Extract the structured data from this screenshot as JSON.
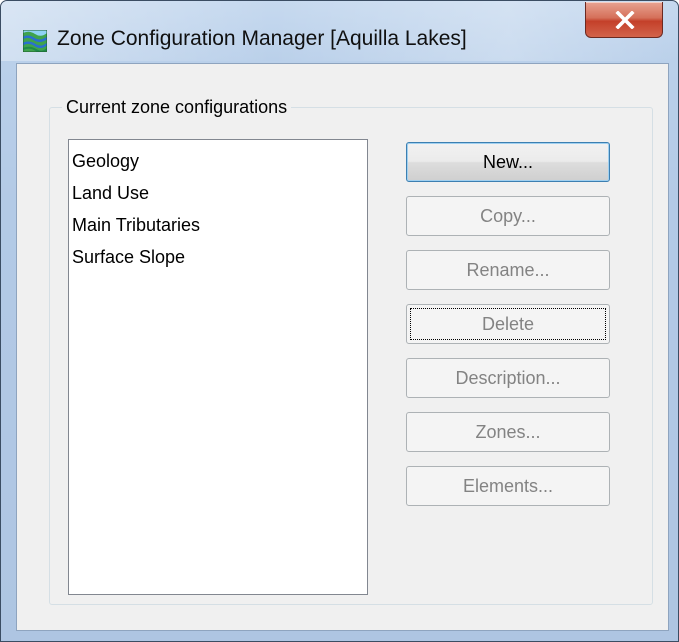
{
  "window": {
    "title": "Zone Configuration Manager [Aquilla Lakes]",
    "close_glyph": "X"
  },
  "group": {
    "label": "Current zone configurations"
  },
  "configurations": [
    "Geology",
    "Land Use",
    "Main Tributaries",
    "Surface Slope"
  ],
  "buttons": {
    "new": "New...",
    "copy": "Copy...",
    "rename": "Rename...",
    "delete": "Delete",
    "description": "Description...",
    "zones": "Zones...",
    "elements": "Elements..."
  },
  "button_states": {
    "new": "enabled-default",
    "copy": "disabled",
    "rename": "disabled",
    "delete": "disabled-focused",
    "description": "disabled",
    "zones": "disabled",
    "elements": "disabled"
  },
  "icons": {
    "app": "terrain-map-icon",
    "close": "close-icon"
  }
}
